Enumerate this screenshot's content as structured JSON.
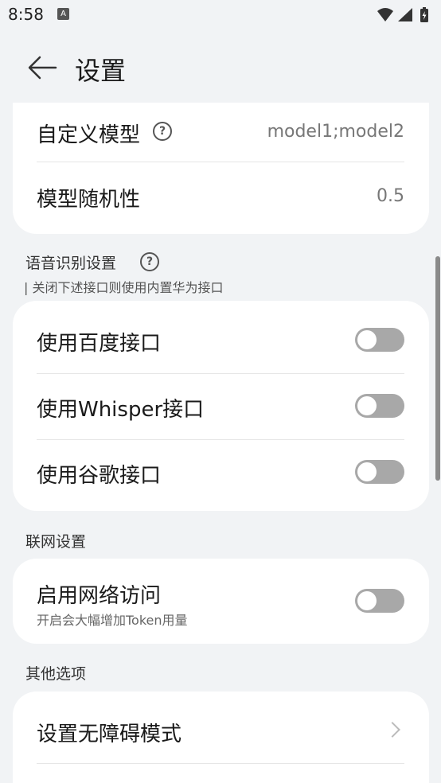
{
  "status_bar": {
    "time": "8:58",
    "app_icon_letter": "A",
    "icons": [
      "wifi-icon",
      "signal-icon",
      "battery-charging-icon"
    ]
  },
  "header": {
    "back_icon": "arrow-left-icon",
    "title": "设置"
  },
  "model_card": {
    "custom_model": {
      "label": "自定义模型",
      "value": "model1;model2",
      "help_icon": "help-circle-icon"
    },
    "randomness": {
      "label": "模型随机性",
      "value": "0.5"
    }
  },
  "speech_section": {
    "title": "语音识别设置",
    "subtitle": "| 关闭下述接口则使用内置华为接口",
    "help_icon": "help-circle-icon",
    "items": [
      {
        "label": "使用百度接口",
        "on": false
      },
      {
        "label": "使用Whisper接口",
        "on": false
      },
      {
        "label": "使用谷歌接口",
        "on": false
      }
    ]
  },
  "network_section": {
    "title": "联网设置",
    "item": {
      "label": "启用网络访问",
      "sub": "开启会大幅增加Token用量",
      "on": false
    }
  },
  "other_section": {
    "title": "其他选项",
    "items": [
      {
        "label": "设置无障碍模式",
        "icon": "chevron-right-icon"
      }
    ]
  },
  "colors": {
    "background": "#f1f3f5",
    "card": "#ffffff",
    "toggle_off": "#a8a8a8"
  }
}
